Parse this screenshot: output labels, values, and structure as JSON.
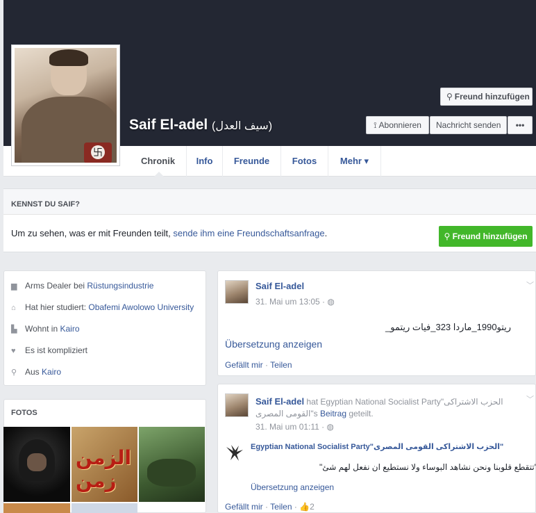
{
  "profile": {
    "name": "Saif El-adel",
    "name_alt": "(سيف العدل)"
  },
  "buttons": {
    "add_friend": "Freund hinzufügen",
    "subscribe": "Abonnieren",
    "message": "Nachricht senden",
    "more": "•••"
  },
  "tabs": [
    "Chronik",
    "Info",
    "Freunde",
    "Fotos",
    "Mehr ▾"
  ],
  "know": {
    "title": "KENNST DU SAIF?",
    "text_prefix": "Um zu sehen, was er mit Freunden teilt, ",
    "text_link": "sende ihm eine Freundschaftsanfrage",
    "text_suffix": ".",
    "button": "Freund hinzufügen"
  },
  "intro": [
    {
      "icon": "briefcase-icon",
      "glyph": "▆",
      "prefix": "Arms Dealer bei ",
      "link": "Rüstungsindustrie"
    },
    {
      "icon": "graduation-cap-icon",
      "glyph": "⌂",
      "prefix": "Hat hier studiert: ",
      "link": "Obafemi Awolowo University"
    },
    {
      "icon": "home-icon",
      "glyph": "▙",
      "prefix": "Wohnt in ",
      "link": "Kairo"
    },
    {
      "icon": "heart-icon",
      "glyph": "♥",
      "prefix": "Es ist kompliziert",
      "link": ""
    },
    {
      "icon": "location-pin-icon",
      "glyph": "⚲",
      "prefix": "Aus ",
      "link": "Kairo"
    }
  ],
  "photos": {
    "title": "FOTOS",
    "tile2_text": "الزمن زمن"
  },
  "posts": [
    {
      "author": "Saif El-adel",
      "time": "31. Mai um 13:05 · ",
      "text": "ريتو1990_ماردا 323_فيات ريتمو_",
      "translate": "Übersetzung anzeigen",
      "like": "Gefällt mir",
      "share": "Teilen"
    },
    {
      "author": "Saif El-adel",
      "shared_mid": " hat Egyptian National Socialist Party\"الحزب الاشتراكى القومى المصرى\"s ",
      "shared_link": "Beitrag",
      "shared_end": " geteilt.",
      "time": "31. Mai um 01:11 · ",
      "source": "Egyptian National Socialist Party\"الحزب الاشتراكى القومى المصرى\"",
      "quote": "\"تتقطع قلوبنا ونحن نشاهد البوساء ولا نستطيع ان نفعل لهم شئ\"",
      "translate": "Übersetzung anzeigen",
      "like": "Gefällt mir",
      "share": "Teilen",
      "likes": "2"
    }
  ],
  "colors": {
    "cover": "#232733",
    "link": "#365899",
    "green": "#42b72a"
  }
}
